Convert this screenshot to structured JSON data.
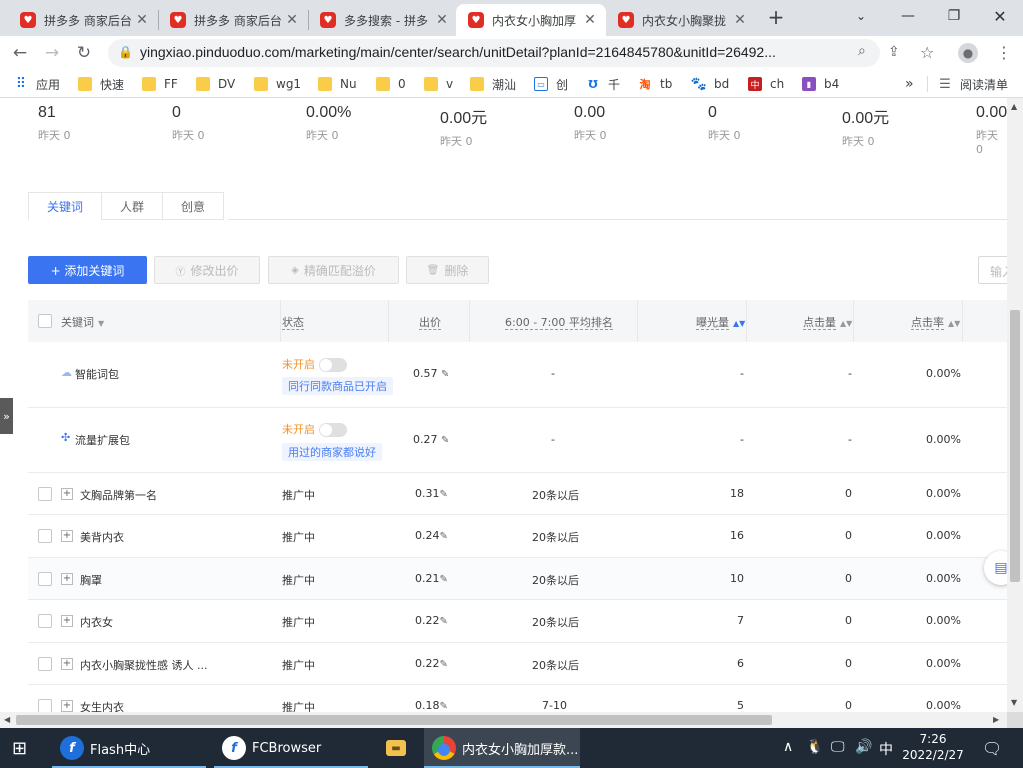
{
  "browser": {
    "tabs": [
      {
        "title": "拼多多 商家后台",
        "active": false
      },
      {
        "title": "拼多多 商家后台",
        "active": false
      },
      {
        "title": "多多搜索 - 拼多",
        "active": false
      },
      {
        "title": "内衣女小胸加厚",
        "active": true
      },
      {
        "title": "内衣女小胸聚拢",
        "active": false
      }
    ],
    "new_tab": "+",
    "url": "yingxiao.pinduoduo.com/marketing/main/center/search/unitDetail?planId=2164845780&unitId=26492...",
    "bookmarks": [
      {
        "label": "应用",
        "icon": "apps-grid-icon"
      },
      {
        "label": "快速",
        "icon": "folder-icon"
      },
      {
        "label": "FF",
        "icon": "folder-icon"
      },
      {
        "label": "DV",
        "icon": "folder-icon"
      },
      {
        "label": "wg1",
        "icon": "folder-icon"
      },
      {
        "label": "Nu",
        "icon": "folder-icon"
      },
      {
        "label": "0",
        "icon": "folder-icon"
      },
      {
        "label": "v",
        "icon": "folder-icon"
      },
      {
        "label": "潮汕",
        "icon": "folder-icon"
      },
      {
        "label": "创",
        "icon": "tv-icon"
      },
      {
        "label": "千",
        "icon": "taobao-icon"
      },
      {
        "label": "tb",
        "icon": "taobao-icon"
      },
      {
        "label": "bd",
        "icon": "baidu-paw-icon"
      },
      {
        "label": "ch",
        "icon": "red-square-icon"
      },
      {
        "label": "b4",
        "icon": "shopping-bag-icon"
      }
    ],
    "more": "»",
    "reading_list": "阅读清单"
  },
  "metrics": [
    {
      "value": "81",
      "sub": "昨天 0"
    },
    {
      "value": "0",
      "sub": "昨天 0"
    },
    {
      "value": "0.00%",
      "sub": "昨天 0"
    },
    {
      "value": "0.00元",
      "sub": "昨天 0"
    },
    {
      "value": "0.00",
      "sub": "昨天 0"
    },
    {
      "value": "0",
      "sub": "昨天 0"
    },
    {
      "value": "0.00元",
      "sub": "昨天 0"
    },
    {
      "value": "0.00",
      "sub": "昨天 0"
    }
  ],
  "page_tabs": [
    "关键词",
    "人群",
    "创意"
  ],
  "actions": {
    "add": "+ 添加关键词",
    "edit_bid": "修改出价",
    "exact_premium": "精确匹配溢价",
    "delete": "删除",
    "search_placeholder": "输入"
  },
  "table": {
    "headers": {
      "keyword": "关键词",
      "status": "状态",
      "bid": "出价",
      "rank": "6:00 - 7:00 平均排名",
      "impressions": "曝光量",
      "clicks": "点击量",
      "ctr": "点击率"
    },
    "packs": [
      {
        "name": "智能词包",
        "status": "未开启",
        "tag": "同行同款商品已开启",
        "bid": "0.57",
        "rank": "-",
        "impressions": "-",
        "clicks": "-",
        "ctr": "0.00%"
      },
      {
        "name": "流量扩展包",
        "status": "未开启",
        "tag": "用过的商家都说好",
        "bid": "0.27",
        "rank": "-",
        "impressions": "-",
        "clicks": "-",
        "ctr": "0.00%"
      }
    ],
    "rows": [
      {
        "keyword": "文胸品牌第一名",
        "status": "推广中",
        "bid": "0.31",
        "rank": "20条以后",
        "impressions": "18",
        "clicks": "0",
        "ctr": "0.00%"
      },
      {
        "keyword": "美背内衣",
        "status": "推广中",
        "bid": "0.24",
        "rank": "20条以后",
        "impressions": "16",
        "clicks": "0",
        "ctr": "0.00%"
      },
      {
        "keyword": "胸罩",
        "status": "推广中",
        "bid": "0.21",
        "rank": "20条以后",
        "impressions": "10",
        "clicks": "0",
        "ctr": "0.00%"
      },
      {
        "keyword": "内衣女",
        "status": "推广中",
        "bid": "0.22",
        "rank": "20条以后",
        "impressions": "7",
        "clicks": "0",
        "ctr": "0.00%"
      },
      {
        "keyword": "内衣小胸聚拢性感 诱人 ...",
        "status": "推广中",
        "bid": "0.22",
        "rank": "20条以后",
        "impressions": "6",
        "clicks": "0",
        "ctr": "0.00%"
      },
      {
        "keyword": "女生内衣",
        "status": "推广中",
        "bid": "0.18",
        "rank": "7-10",
        "impressions": "5",
        "clicks": "0",
        "ctr": "0.00%"
      }
    ]
  },
  "taskbar": {
    "items": [
      {
        "label": "Flash中心",
        "icon": "flash-center-icon"
      },
      {
        "label": "FCBrowser",
        "icon": "fcbrowser-icon"
      },
      {
        "label": "",
        "icon": "file-explorer-icon"
      },
      {
        "label": "内衣女小胸加厚款...",
        "icon": "chrome-icon"
      }
    ],
    "ime": "中",
    "time": "7:26",
    "date": "2022/2/27"
  },
  "colors": {
    "accent": "#3a74f0",
    "status_orange": "#f5922c",
    "pdd_red": "#e02e24"
  }
}
